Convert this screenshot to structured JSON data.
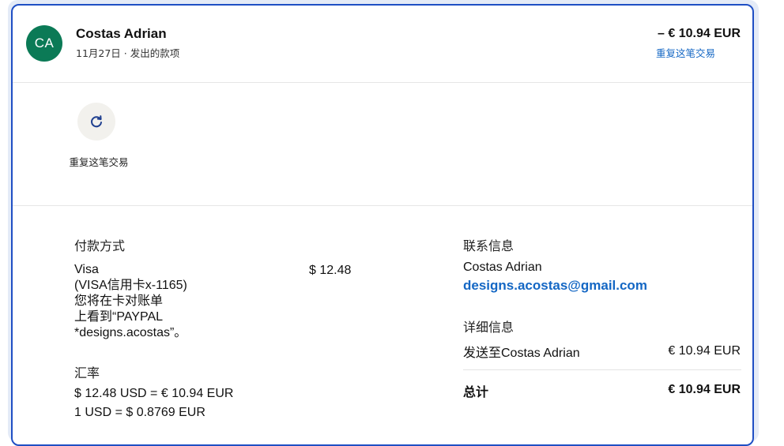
{
  "header": {
    "avatar_initials": "CA",
    "name": "Costas Adrian",
    "subline": "11月27日 · 发出的款项",
    "amount": "– € 10.94 EUR",
    "repeat_link": "重复这笔交易"
  },
  "actions": {
    "repeat_icon": "refresh-icon",
    "repeat_label": "重复这笔交易"
  },
  "payment": {
    "title": "付款方式",
    "description": "Visa\n(VISA信用卡x-1165)\n您将在卡对账单\n上看到“PAYPAL\n*designs.acostas”。",
    "amount": "$ 12.48"
  },
  "exchange": {
    "title": "汇率",
    "line1": "$ 12.48 USD = € 10.94 EUR",
    "line2": "1 USD = $ 0.8769 EUR"
  },
  "contact": {
    "title": "联系信息",
    "name": "Costas Adrian",
    "email": "designs.acostas@gmail.com"
  },
  "details": {
    "title": "详细信息",
    "sent_to_label": "发送至Costas Adrian",
    "sent_to_amount": "€ 10.94 EUR",
    "total_label": "总计",
    "total_amount": "€ 10.94 EUR"
  },
  "colors": {
    "accent": "#1467c4",
    "avatar": "#0b7a56",
    "frame_border": "#1f4fc4"
  }
}
